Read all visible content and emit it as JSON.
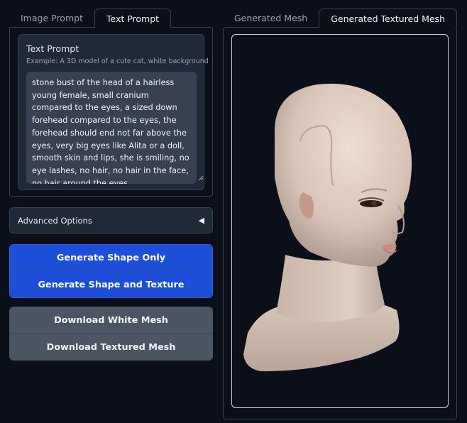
{
  "left_tabs": [
    "Image Prompt",
    "Text Prompt"
  ],
  "right_tabs": [
    "Generated Mesh",
    "Generated Textured Mesh"
  ],
  "prompt": {
    "label": "Text Prompt",
    "hint": "Example: A 3D model of a cute cat, white background",
    "value": "stone bust of the head of a hairless young female, small cranium compared to the eyes, a sized down forehead compared to the eyes, the forehead should end not far above the eyes, very big eyes like Alita or a doll, smooth skin and lips, she is smiling, no eye lashes, no hair, no hair in the face, no hair around the eyes"
  },
  "advanced": {
    "label": "Advanced Options",
    "icon": "caret-left-icon"
  },
  "buttons": {
    "shape_only": "Generate Shape Only",
    "shape_texture": "Generate Shape and Texture",
    "download_white": "Download White Mesh",
    "download_textured": "Download Textured Mesh"
  },
  "colors": {
    "background": "#0b0f19",
    "panel": "#1f2937",
    "primary": "#1d4ed8",
    "secondary": "#4b5563"
  }
}
